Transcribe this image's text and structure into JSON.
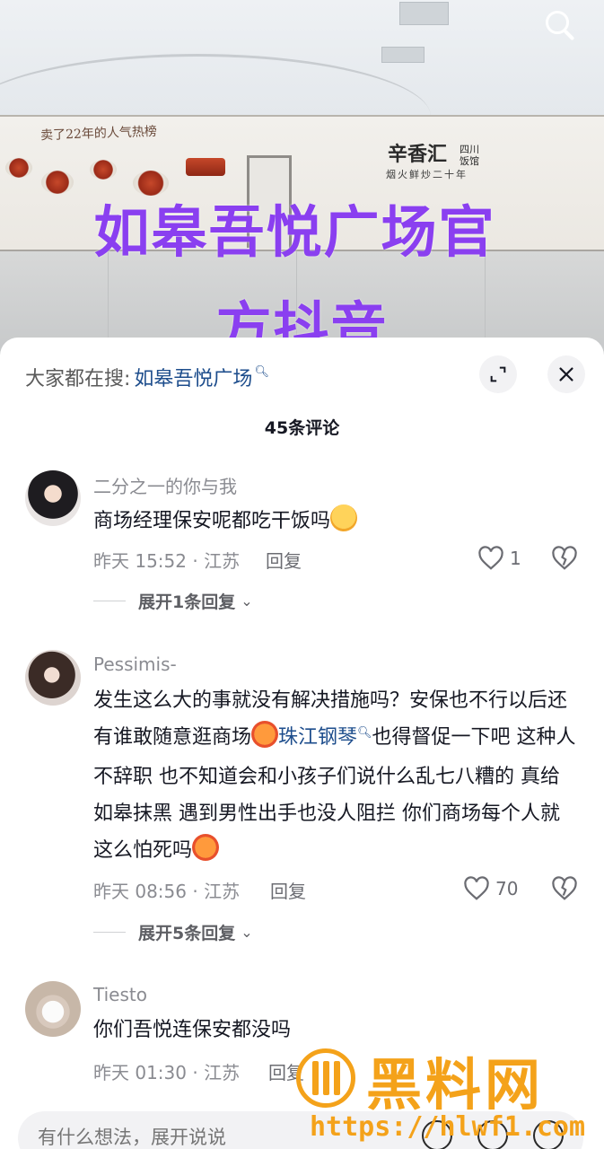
{
  "video": {
    "overlay_line1": "如皋吾悦广场官",
    "overlay_line2": "方抖音",
    "wall_script": "卖了22年的人气热榜",
    "brand_name": "辛香汇",
    "brand_side": "四川饭馆",
    "brand_slogan": "烟火鲜炒二十年",
    "search_icon": "search-icon"
  },
  "panel": {
    "suggest_prefix": "大家都在搜:",
    "suggest_keyword": "如皋吾悦广场",
    "comment_count": "45条评论",
    "expand_icon": "expand-icon",
    "close_icon": "close-icon"
  },
  "comments": [
    {
      "user": "二分之一的你与我",
      "text": "商场经理保安呢都吃干饭吗",
      "time_loc": "昨天 15:52 · 江苏",
      "reply_label": "回复",
      "likes": "1",
      "more_replies": "展开1条回复"
    },
    {
      "user": "Pessimis-",
      "text_a": "发生这么大的事就没有解决措施吗？安保也不行以后还有谁敢随意逛商场",
      "link": "珠江钢琴",
      "text_b": "也得督促一下吧 这种人不辞职 也不知道会和小孩子们说什么乱七八糟的 真给如皋抹黑 遇到男性出手也没人阻拦 你们商场每个人就这么怕死吗",
      "time_loc": "昨天 08:56 · 江苏",
      "reply_label": "回复",
      "likes": "70",
      "more_replies": "展开5条回复"
    },
    {
      "user": "Tiesto",
      "text": "你们吾悦连保安都没吗",
      "time_loc": "昨天 01:30 · 江苏",
      "reply_label": "回复"
    }
  ],
  "input": {
    "placeholder": "有什么想法，展开说说"
  },
  "watermark": {
    "name": "黑料网",
    "url": "https://hlwf1.com"
  },
  "colors": {
    "overlay_text": "#8a3ff0",
    "link": "#1d4d8c",
    "watermark": "#f4a21a"
  }
}
